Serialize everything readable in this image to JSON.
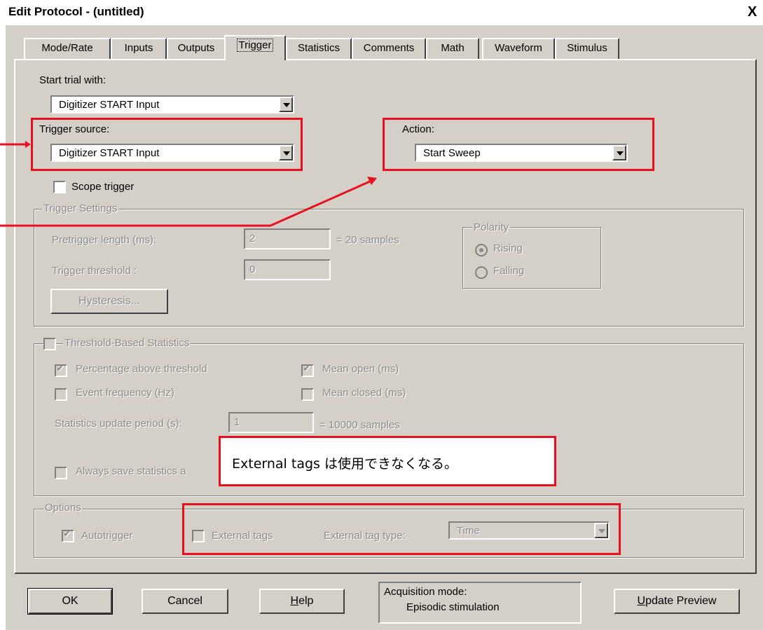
{
  "window": {
    "title": "Edit Protocol - (untitled)",
    "close_glyph": "X"
  },
  "tabs": [
    {
      "label": "Mode/Rate"
    },
    {
      "label": "Inputs"
    },
    {
      "label": "Outputs"
    },
    {
      "label": "Trigger"
    },
    {
      "label": "Statistics"
    },
    {
      "label": "Comments"
    },
    {
      "label": "Math"
    },
    {
      "label": "Waveform"
    },
    {
      "label": "Stimulus"
    }
  ],
  "trigger": {
    "start_trial_label": "Start trial with:",
    "start_trial_value": "Digitizer START Input",
    "source_label": "Trigger source:",
    "source_value": "Digitizer START Input",
    "action_label": "Action:",
    "action_value": "Start Sweep",
    "scope_trigger_label": "Scope trigger"
  },
  "settings": {
    "legend": "Trigger Settings",
    "pretrigger_label": "Pretrigger length (ms):",
    "pretrigger_value": "2",
    "pretrigger_samples": "= 20 samples",
    "threshold_label": "Trigger threshold :",
    "threshold_value": "0",
    "hysteresis_label": "Hysteresis...",
    "polarity_legend": "Polarity",
    "rising_label": "Rising",
    "falling_label": "Falling"
  },
  "stats": {
    "legend": "Threshold-Based Statistics",
    "pct_above": "Percentage above threshold",
    "mean_open": "Mean open (ms)",
    "event_freq": "Event frequency (Hz)",
    "mean_closed": "Mean closed (ms)",
    "update_label": "Statistics update period (s):",
    "update_value": "1",
    "update_samples": "= 10000 samples",
    "always_save": "Always save statistics a"
  },
  "options": {
    "legend": "Options",
    "autotrigger": "Autotrigger",
    "external_tags": "External tags",
    "tag_type_label": "External tag type:",
    "tag_type_value": "Time"
  },
  "buttons": {
    "ok": "OK",
    "cancel": "Cancel",
    "help": "Help",
    "update_preview": "Update Preview"
  },
  "acquisition": {
    "line1": "Acquisition mode:",
    "line2": "Episodic stimulation"
  },
  "annotation": {
    "note": "External tags は使用できなくなる。"
  },
  "colors": {
    "highlight": "#e8101f",
    "face": "#d4d0c8"
  }
}
